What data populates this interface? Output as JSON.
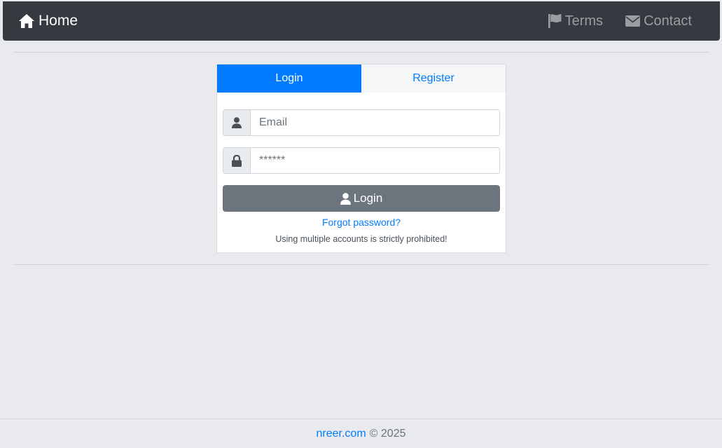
{
  "navbar": {
    "brand_label": "Home",
    "brand_icon": "home-icon",
    "links": [
      {
        "label": "Terms",
        "icon": "flag-icon"
      },
      {
        "label": "Contact",
        "icon": "envelope-icon"
      }
    ]
  },
  "auth": {
    "tabs": [
      {
        "label": "Login",
        "active": true
      },
      {
        "label": "Register",
        "active": false
      }
    ],
    "email": {
      "placeholder": "Email",
      "value": "",
      "icon": "user-icon"
    },
    "password": {
      "placeholder": "******",
      "value": "",
      "icon": "lock-icon"
    },
    "submit_label": "Login",
    "submit_icon": "user-icon",
    "forgot_label": "Forgot password?",
    "notice": "Using multiple accounts is strictly prohibited!"
  },
  "footer": {
    "site_link": "nreer.com",
    "copyright": "© 2025"
  },
  "colors": {
    "navbar": "#343a40",
    "primary": "#007bff",
    "secondary_button": "#6c757d",
    "page_background": "#e9eaee"
  }
}
